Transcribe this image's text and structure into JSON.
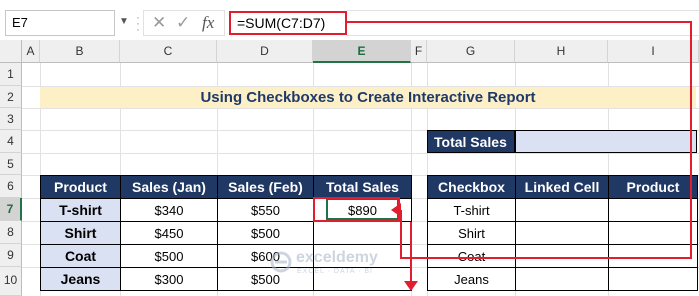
{
  "formula_bar": {
    "name_box": "E7",
    "formula": "=SUM(C7:D7)",
    "cancel_icon": "cancel-icon",
    "enter_icon": "check-icon",
    "fx_label": "fx"
  },
  "columns": [
    "A",
    "B",
    "C",
    "D",
    "E",
    "F",
    "G",
    "H",
    "I"
  ],
  "rows": [
    "1",
    "2",
    "3",
    "4",
    "5",
    "6",
    "7",
    "8",
    "9",
    "10"
  ],
  "title": "Using Checkboxes to Create Interactive Report",
  "total_sales": {
    "label": "Total Sales",
    "value": ""
  },
  "sales_table": {
    "headers": [
      "Product",
      "Sales (Jan)",
      "Sales (Feb)",
      "Total Sales"
    ],
    "rows": [
      [
        "T-shirt",
        "$340",
        "$550",
        "$890"
      ],
      [
        "Shirt",
        "$450",
        "$500",
        ""
      ],
      [
        "Coat",
        "$500",
        "$600",
        ""
      ],
      [
        "Jeans",
        "$300",
        "$500",
        ""
      ]
    ]
  },
  "checkbox_table": {
    "headers": [
      "Checkbox",
      "Linked Cell",
      "Product"
    ],
    "rows": [
      [
        "T-shirt",
        "",
        ""
      ],
      [
        "Shirt",
        "",
        ""
      ],
      [
        "Coat",
        "",
        ""
      ],
      [
        "Jeans",
        "",
        ""
      ]
    ]
  },
  "watermark": {
    "name": "exceldemy",
    "tagline": "EXCEL · DATA · BI"
  },
  "colors": {
    "header_bg": "#203864",
    "title_bg": "#fdefc6",
    "product_bg": "#d9e1f2",
    "annotation": "#e01e2d",
    "excel_green": "#217346"
  }
}
